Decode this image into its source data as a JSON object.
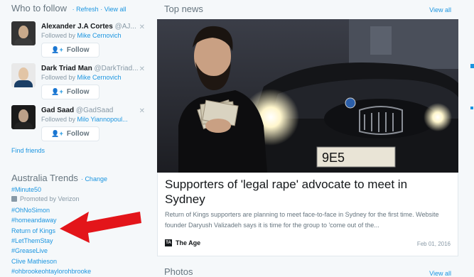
{
  "who_to_follow": {
    "title": "Who to follow",
    "refresh": "Refresh",
    "view_all": "View all",
    "users": [
      {
        "name": "Alexander J.A Cortes",
        "handle": "@AJ...",
        "followed_by_label": "Followed by",
        "followed_by": "Mike Cernovich",
        "follow_label": "Follow"
      },
      {
        "name": "Dark Triad Man",
        "handle": "@DarkTriad...",
        "followed_by_label": "Followed by",
        "followed_by": "Mike Cernovich",
        "follow_label": "Follow"
      },
      {
        "name": "Gad Saad",
        "handle": "@GadSaad",
        "followed_by_label": "Followed by",
        "followed_by": "Milo Yiannopoul...",
        "follow_label": "Follow"
      }
    ],
    "find_friends": "Find friends"
  },
  "trends": {
    "title": "Australia Trends",
    "change": "Change",
    "items": [
      "#Minute50",
      "#OhNoSimon",
      "#homeandaway",
      "Return of Kings",
      "#LetThemStay",
      "#GreaseLive",
      "Clive Mathieson",
      "#ohbrookeohtaylorohbrooke"
    ],
    "promoted_label": "Promoted by Verizon"
  },
  "top_news": {
    "title": "Top news",
    "view_all": "View all",
    "headline": "Supporters of 'legal rape' advocate to meet in Sydney",
    "description": "Return of Kings supporters are planning to meet face-to-face in Sydney for the first time. Website founder Daryush Valizadeh says it is time for the group to 'come out of the...",
    "source": "The Age",
    "source_logo": "TA",
    "date": "Feb 01, 2016",
    "plate_text": "9E5"
  },
  "photos": {
    "title": "Photos",
    "view_all": "View all"
  },
  "colors": {
    "link": "#1b95e0",
    "arrow": "#e3151a",
    "muted": "#66757f"
  }
}
